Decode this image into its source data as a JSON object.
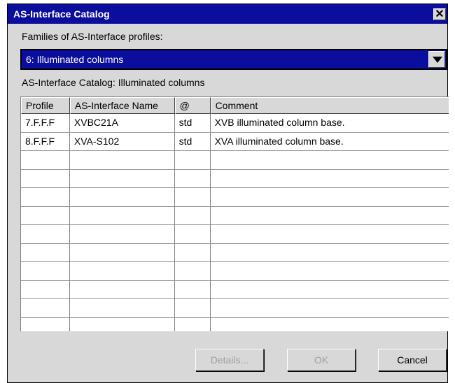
{
  "window": {
    "title": "AS-Interface Catalog",
    "close_glyph": "✕"
  },
  "families": {
    "label": "Families of AS-Interface profiles:",
    "selected": "6: Illuminated columns"
  },
  "catalog": {
    "label": "AS-Interface Catalog: Illuminated columns",
    "columns": [
      "Profile",
      "AS-Interface Name",
      "@",
      "Comment"
    ],
    "rows": [
      [
        "7.F.F.F",
        "XVBC21A",
        "std",
        "XVB illuminated column base."
      ],
      [
        "8.F.F.F",
        "XVA-S102",
        "std",
        "XVA illuminated column base."
      ]
    ],
    "empty_rows": 10
  },
  "buttons": {
    "details": "Details...",
    "ok": "OK",
    "cancel": "Cancel"
  }
}
